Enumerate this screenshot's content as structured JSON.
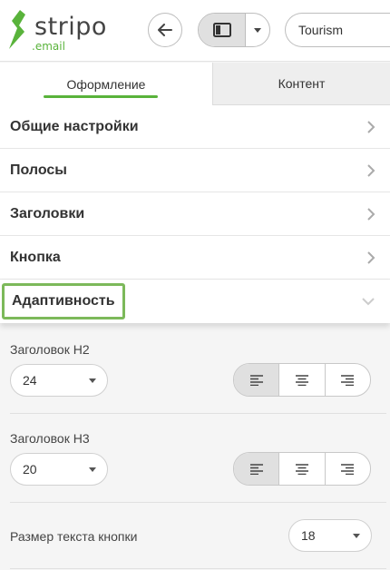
{
  "app": {
    "logo_text": "stripo",
    "logo_sub": ".email"
  },
  "toolbar": {
    "search_value": "Tourism"
  },
  "tabs": [
    {
      "label": "Оформление",
      "active": true
    },
    {
      "label": "Контент",
      "active": false
    }
  ],
  "accordion": {
    "items": [
      {
        "label": "Общие настройки"
      },
      {
        "label": "Полосы"
      },
      {
        "label": "Заголовки"
      },
      {
        "label": "Кнопка"
      }
    ],
    "open_item": {
      "label": "Адаптивность"
    }
  },
  "settings": {
    "h2": {
      "label": "Заголовок H2",
      "value": "24",
      "alignment": "left"
    },
    "h3": {
      "label": "Заголовок H3",
      "value": "20",
      "alignment": "left"
    },
    "button_text": {
      "label": "Размер текста кнопки",
      "value": "18"
    }
  },
  "colors": {
    "accent": "#59b33b",
    "highlight_border": "#7cb95a"
  }
}
